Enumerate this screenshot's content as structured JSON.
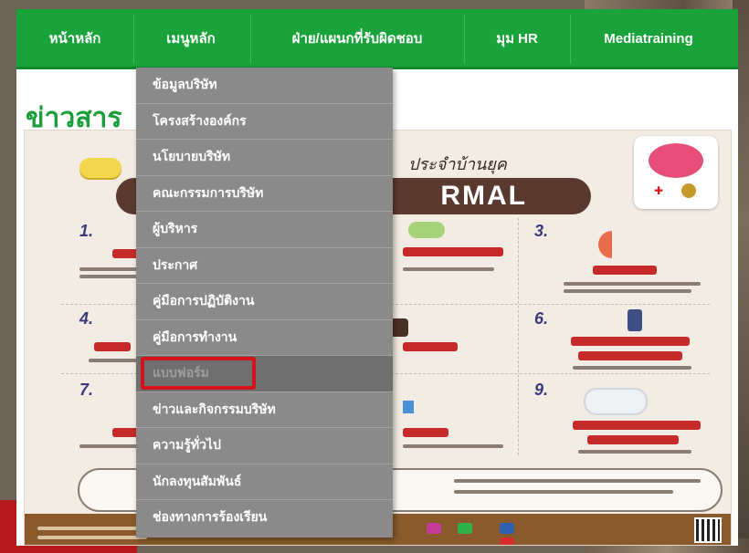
{
  "nav": {
    "items": [
      {
        "label": "หน้าหลัก"
      },
      {
        "label": "เมนูหลัก"
      },
      {
        "label": "ฝ่าย/แผนกที่รับผิดชอบ"
      },
      {
        "label": "มุม HR"
      },
      {
        "label": "Mediatraining"
      }
    ]
  },
  "page": {
    "section_title": "ข่าวสาร"
  },
  "poster": {
    "headline": "ประจำบ้านยุค",
    "title": "RMAL",
    "numbers": [
      "1.",
      "3.",
      "4.",
      "6.",
      "7.",
      "9."
    ]
  },
  "dropdown": {
    "items": [
      {
        "label": "ข้อมูลบริษัท"
      },
      {
        "label": "โครงสร้างองค์กร"
      },
      {
        "label": "นโยบายบริษัท"
      },
      {
        "label": "คณะกรรมการบริษัท"
      },
      {
        "label": "ผู้บริหาร"
      },
      {
        "label": "ประกาศ"
      },
      {
        "label": "คู่มือการปฏิบัติงาน"
      },
      {
        "label": "คู่มือการทำงาน"
      },
      {
        "label": "แบบฟอร์ม"
      },
      {
        "label": "ข่าวและกิจกรรมบริษัท"
      },
      {
        "label": "ความรู้ทั่วไป"
      },
      {
        "label": "นักลงทุนสัมพันธ์"
      },
      {
        "label": "ช่องทางการร้องเรียน"
      }
    ],
    "active_index": 8
  },
  "colors": {
    "nav_green": "#1aa33a",
    "dropdown_gray": "#8a8a8a",
    "highlight_red": "#d4121b"
  }
}
